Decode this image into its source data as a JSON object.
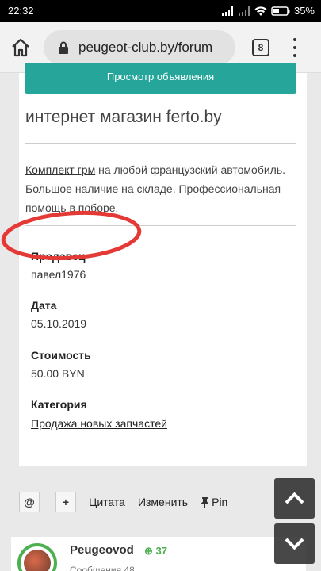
{
  "status": {
    "time": "22:32",
    "battery": "35%"
  },
  "browser": {
    "url": "peugeot-club.by/forum",
    "tab_count": "8"
  },
  "listing": {
    "view_button": "Просмотр объявления",
    "shop_title": "интернет магазин ferto.by",
    "desc_link": "Комплект грм",
    "desc_text": " на любой французский автомобиль. Большое наличие на складе. Профессиональная помощь в поборе.",
    "fields": [
      {
        "label": "Продавец",
        "value": "павел1976"
      },
      {
        "label": "Дата",
        "value": "05.10.2019"
      },
      {
        "label": "Стоимость",
        "value": "50.00 BYN"
      },
      {
        "label": "Категория",
        "value": "Продажа новых запчастей"
      }
    ]
  },
  "actions": {
    "mention": "@",
    "plus": "+",
    "quote": "Цитата",
    "edit": "Изменить",
    "pin": "Pin"
  },
  "next_post": {
    "username": "Peugeovod",
    "reputation": "37",
    "sub_a": "Сообщения",
    "sub_b": "48"
  },
  "colors": {
    "accent": "#26a69a",
    "annotation": "#e53935",
    "reputation": "#4caf50"
  }
}
